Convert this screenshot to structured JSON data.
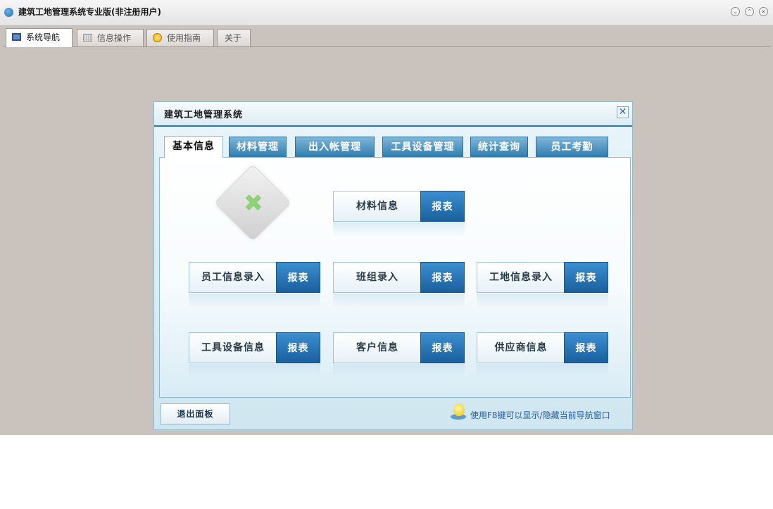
{
  "window": {
    "title": "建筑工地管理系统专业版(非注册用户)",
    "controls": {
      "minimize": "⌄",
      "maximize": "⌃",
      "close": "×"
    }
  },
  "top_tabs": [
    {
      "label": "系统导航",
      "icon": "monitor-icon",
      "active": true
    },
    {
      "label": "信息操作",
      "icon": "grid-icon",
      "active": false
    },
    {
      "label": "使用指南",
      "icon": "guide-icon",
      "active": false
    },
    {
      "label": "关于",
      "icon": "",
      "active": false
    }
  ],
  "dialog": {
    "title": "建筑工地管理系统",
    "close_glyph": "✕",
    "tabs": [
      "基本信息",
      "材料管理",
      "出入帐管理",
      "工具设备管理",
      "统计查询",
      "员工考勤"
    ],
    "active_tab": "基本信息",
    "big_icon": "tools-icon",
    "buttons": [
      {
        "label": "材料信息",
        "report": "报表"
      },
      {
        "label": "员工信息录入",
        "report": "报表"
      },
      {
        "label": "班组录入",
        "report": "报表"
      },
      {
        "label": "工地信息录入",
        "report": "报表"
      },
      {
        "label": "工具设备信息",
        "report": "报表"
      },
      {
        "label": "客户信息",
        "report": "报表"
      },
      {
        "label": "供应商信息",
        "report": "报表"
      }
    ],
    "exit_button": "退出面板",
    "hint_text": "使用F8键可以显示/隐藏当前导航窗口"
  },
  "colors": {
    "accent": "#2d78a8",
    "report_button": "#1f6aaa",
    "background": "#c9c2bd"
  }
}
